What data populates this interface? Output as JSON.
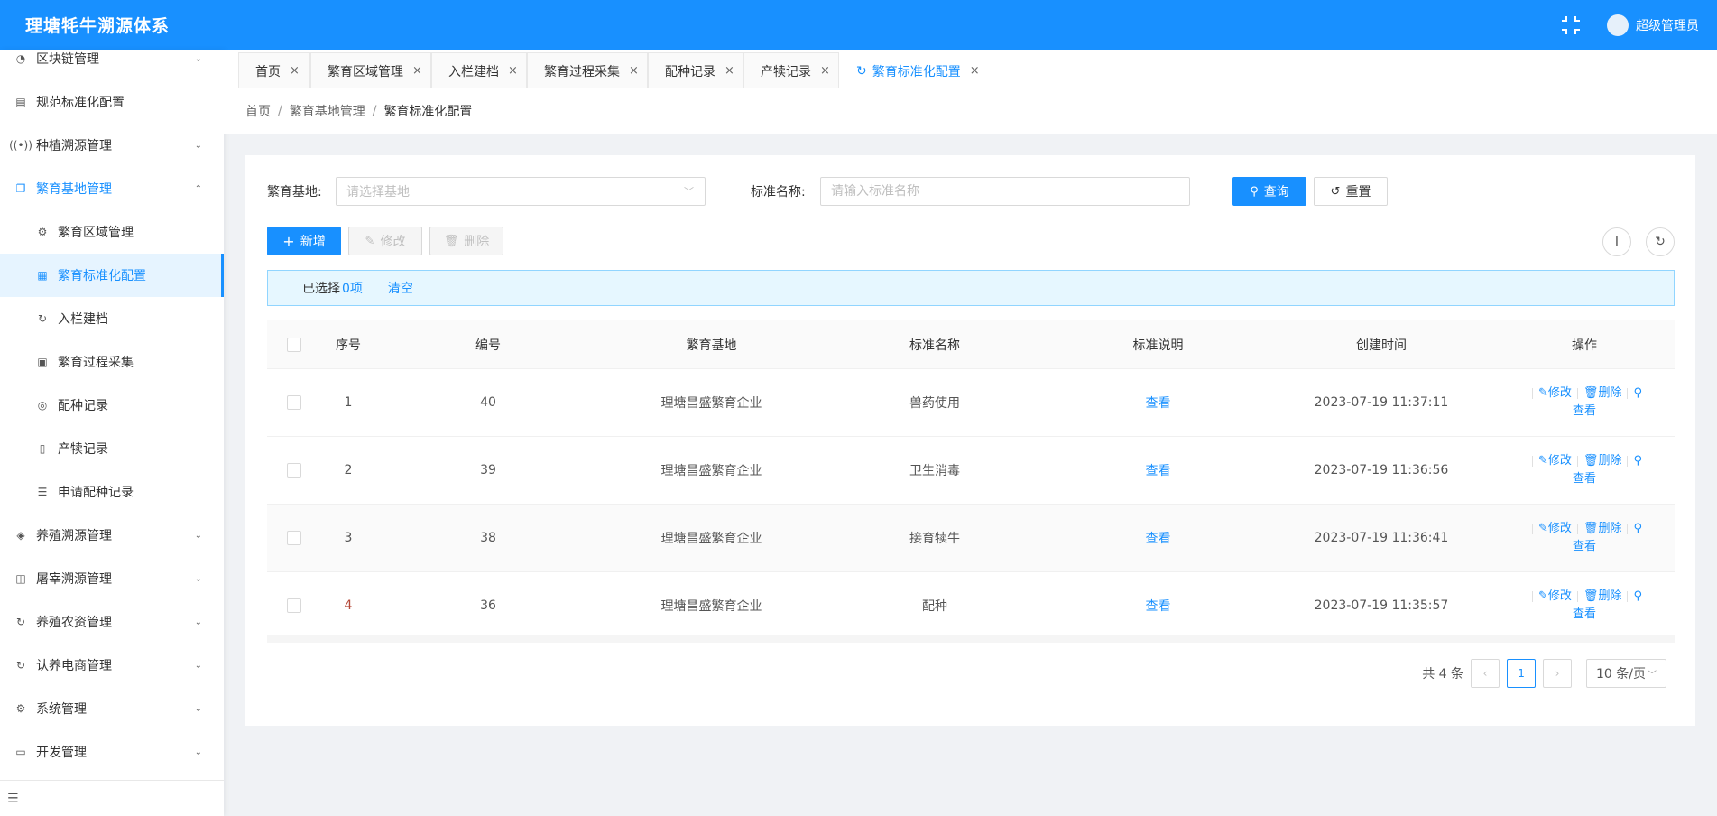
{
  "header": {
    "title": "理塘牦牛溯源体系",
    "user": "超级管理员"
  },
  "sidebar": {
    "items": [
      {
        "label": "区块链管理",
        "icon": "dashboard-icon",
        "arrow": "⌄"
      },
      {
        "label": "规范标准化配置",
        "icon": "document-icon",
        "arrow": ""
      },
      {
        "label": "种植溯源管理",
        "icon": "broadcast-icon",
        "arrow": "⌄"
      },
      {
        "label": "繁育基地管理",
        "icon": "copy-icon",
        "arrow": "⌃"
      }
    ],
    "sub_items": [
      {
        "label": "繁育区域管理",
        "icon": "gear-icon"
      },
      {
        "label": "繁育标准化配置",
        "icon": "table-icon"
      },
      {
        "label": "入栏建档",
        "icon": "sync-icon"
      },
      {
        "label": "繁育过程采集",
        "icon": "files-icon"
      },
      {
        "label": "配种记录",
        "icon": "record-icon"
      },
      {
        "label": "产犊记录",
        "icon": "mobile-icon"
      },
      {
        "label": "申请配种记录",
        "icon": "sliders-icon"
      }
    ],
    "items_after": [
      {
        "label": "养殖溯源管理",
        "icon": "layers-icon",
        "arrow": "⌄"
      },
      {
        "label": "屠宰溯源管理",
        "icon": "fund-icon",
        "arrow": "⌄"
      },
      {
        "label": "养殖农资管理",
        "icon": "sync-icon",
        "arrow": "⌄"
      },
      {
        "label": "认养电商管理",
        "icon": "sync-icon",
        "arrow": "⌄"
      },
      {
        "label": "系统管理",
        "icon": "gear-icon",
        "arrow": "⌄"
      },
      {
        "label": "开发管理",
        "icon": "briefcase-icon",
        "arrow": "⌄"
      }
    ]
  },
  "tabs": [
    "首页",
    "繁育区域管理",
    "入栏建档",
    "繁育过程采集",
    "配种记录",
    "产犊记录",
    "繁育标准化配置"
  ],
  "breadcrumb": [
    "首页",
    "繁育基地管理",
    "繁育标准化配置"
  ],
  "search": {
    "base_label": "繁育基地:",
    "base_placeholder": "请选择基地",
    "name_label": "标准名称:",
    "name_placeholder": "请输入标准名称",
    "query_label": "查询",
    "reset_label": "重置"
  },
  "toolbar": {
    "add_label": "新增",
    "edit_label": "修改",
    "delete_label": "删除"
  },
  "selection": {
    "prefix": "已选择",
    "count": "0项",
    "clear_label": "清空"
  },
  "table": {
    "columns": [
      "序号",
      "编号",
      "繁育基地",
      "标准名称",
      "标准说明",
      "创建时间",
      "操作"
    ],
    "rows": [
      {
        "idx": "1",
        "no": "40",
        "base": "理塘昌盛繁育企业",
        "name": "兽药使用",
        "desc": "查看",
        "time": "2023-07-19 11:37:11"
      },
      {
        "idx": "2",
        "no": "39",
        "base": "理塘昌盛繁育企业",
        "name": "卫生消毒",
        "desc": "查看",
        "time": "2023-07-19 11:36:56"
      },
      {
        "idx": "3",
        "no": "38",
        "base": "理塘昌盛繁育企业",
        "name": "接育犊牛",
        "desc": "查看",
        "time": "2023-07-19 11:36:41"
      },
      {
        "idx": "4",
        "no": "36",
        "base": "理塘昌盛繁育企业",
        "name": "配种",
        "desc": "查看",
        "time": "2023-07-19 11:35:57"
      }
    ],
    "op_edit": "修改",
    "op_delete": "删除",
    "op_view": "查看"
  },
  "pagination": {
    "total_text": "共 4 条",
    "current_page": "1",
    "page_size": "10 条/页"
  },
  "colors": {
    "primary": "#1890ff",
    "index_red": "#b54a3a"
  }
}
